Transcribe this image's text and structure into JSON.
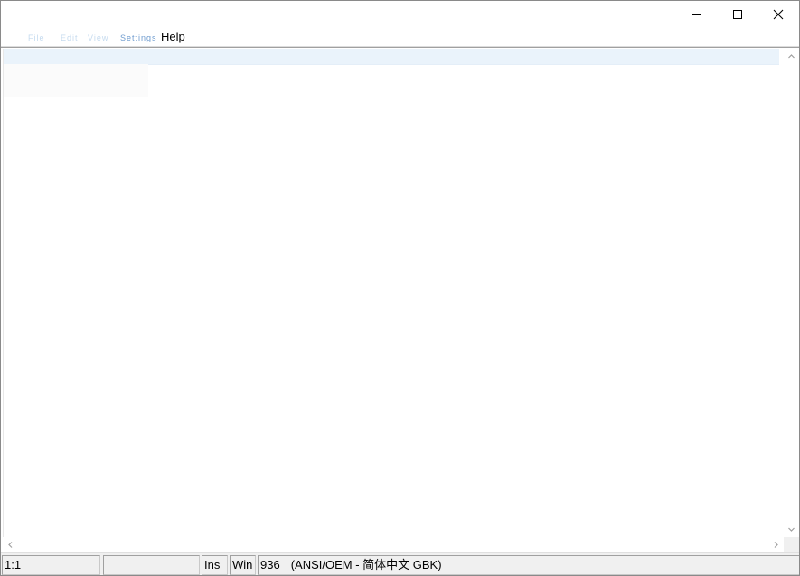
{
  "menubar": {
    "faint_items": [
      "File",
      "Edit",
      "View",
      "Settings",
      "?"
    ],
    "help_label": "Help",
    "help_accel": "H",
    "help_rest": "elp"
  },
  "statusbar": {
    "position": "1:1",
    "selection": "",
    "insert_mode": "Ins",
    "line_endings": "Win",
    "codepage": "936",
    "encoding": "(ANSI/OEM - 简体中文 GBK)"
  },
  "colors": {
    "current_line": "#eaf3fb",
    "status_bg": "#f0f0f0"
  },
  "icons": [
    "minimize-icon",
    "maximize-icon",
    "close-icon",
    "scroll-up-arrow-icon",
    "scroll-down-arrow-icon",
    "scroll-left-arrow-icon",
    "scroll-right-arrow-icon"
  ]
}
